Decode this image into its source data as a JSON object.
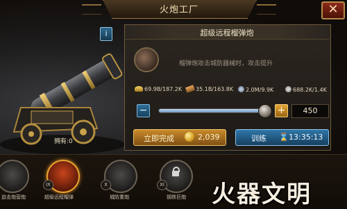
{
  "header": {
    "title": "火炮工厂",
    "close_glyph": "✕"
  },
  "cannon": {
    "owned_label": "拥有:0",
    "info_glyph": "i"
  },
  "panel": {
    "title": "超级远程榴弹炮",
    "description": "榴弹炮攻击城防器械时，攻击提升",
    "resources": [
      {
        "icon": "gold-icon",
        "value": "69.9B/187.2K"
      },
      {
        "icon": "wood-icon",
        "value": "35.1B/163.8K"
      },
      {
        "icon": "ore-icon",
        "value": "2.0M/9.9K"
      },
      {
        "icon": "stone-icon",
        "value": "688.2K/1.4K"
      }
    ],
    "slider": {
      "minus": "−",
      "plus": "+",
      "fill_fraction": 0.95,
      "quantity": "450"
    },
    "instant_button": {
      "label": "立即完成",
      "cost": "2,039"
    },
    "train_button": {
      "label": "训练",
      "time": "13:35:13"
    }
  },
  "units": [
    {
      "roman": "",
      "label": "迫击炮营炮",
      "selected": false
    },
    {
      "roman": "IX",
      "label": "超级远程榴弹",
      "selected": true
    },
    {
      "roman": "X",
      "label": "城防重炮",
      "selected": false
    },
    {
      "roman": "XI",
      "label": "钢铁巨炮",
      "selected": false,
      "locked": true
    }
  ],
  "watermark": "火器文明",
  "colors": {
    "accent_gold": "#c98a2b",
    "accent_blue": "#2f76a8",
    "panel_border": "#6e5a3a"
  }
}
